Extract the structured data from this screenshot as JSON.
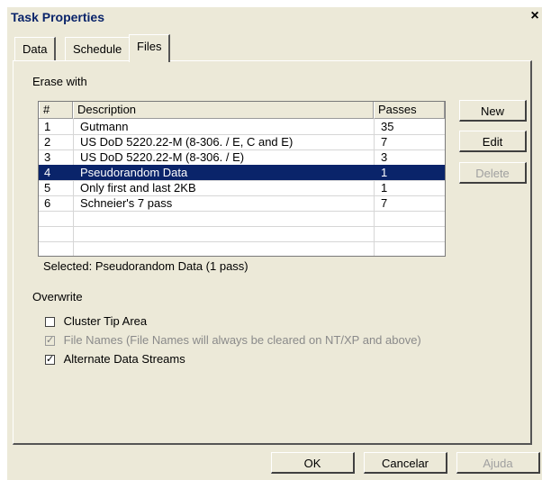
{
  "window": {
    "title": "Task Properties",
    "close_glyph": "×"
  },
  "tabs": [
    {
      "label": "Data"
    },
    {
      "label": "Schedule"
    },
    {
      "label": "Files",
      "active": true
    }
  ],
  "erase": {
    "group_label": "Erase with",
    "columns": [
      "#",
      "Description",
      "Passes"
    ],
    "rows": [
      {
        "num": "1",
        "desc": "Gutmann",
        "passes": "35"
      },
      {
        "num": "2",
        "desc": "US DoD 5220.22-M (8-306. / E, C and E)",
        "passes": "7"
      },
      {
        "num": "3",
        "desc": "US DoD 5220.22-M (8-306. / E)",
        "passes": "3"
      },
      {
        "num": "4",
        "desc": "Pseudorandom Data",
        "passes": "1",
        "selected": true
      },
      {
        "num": "5",
        "desc": "Only first and last 2KB",
        "passes": "1"
      },
      {
        "num": "6",
        "desc": "Schneier's 7 pass",
        "passes": "7"
      }
    ],
    "selected_text": "Selected: Pseudorandom Data (1 pass)"
  },
  "side_buttons": {
    "new": "New",
    "edit": "Edit",
    "delete": "Delete"
  },
  "overwrite": {
    "label": "Overwrite",
    "options": [
      {
        "label": "Cluster Tip Area",
        "checked": false,
        "disabled": false
      },
      {
        "label": "File Names (File Names will always be cleared on NT/XP and above)",
        "checked": true,
        "disabled": true
      },
      {
        "label": "Alternate Data Streams",
        "checked": true,
        "disabled": false
      }
    ]
  },
  "footer": {
    "ok": "OK",
    "cancel": "Cancelar",
    "help": "Ajuda"
  },
  "colors": {
    "selection": "#0a246a",
    "dialog_bg": "#ece9d8"
  }
}
